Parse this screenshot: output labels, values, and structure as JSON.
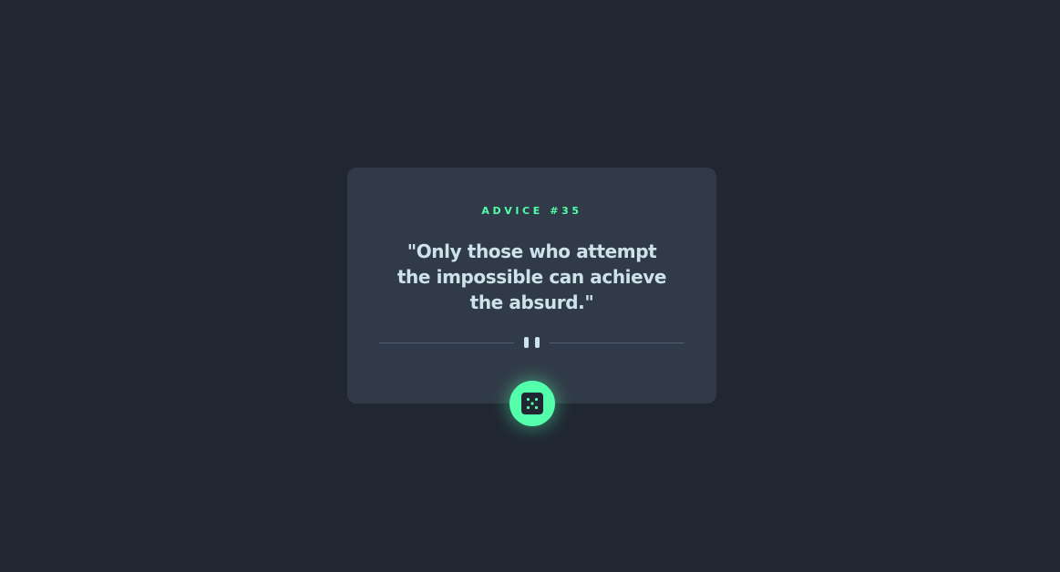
{
  "advice": {
    "label": "ADVICE #35",
    "quote": "\"Only those who attempt the impossible can achieve the absurd.\""
  },
  "divider": {
    "icon": "pause-icon"
  },
  "button": {
    "icon": "dice-icon"
  },
  "colors": {
    "background": "#202733",
    "card": "#313a48",
    "accent": "#53ffaa",
    "text": "#cee3e9",
    "divider": "#4f5d74"
  }
}
